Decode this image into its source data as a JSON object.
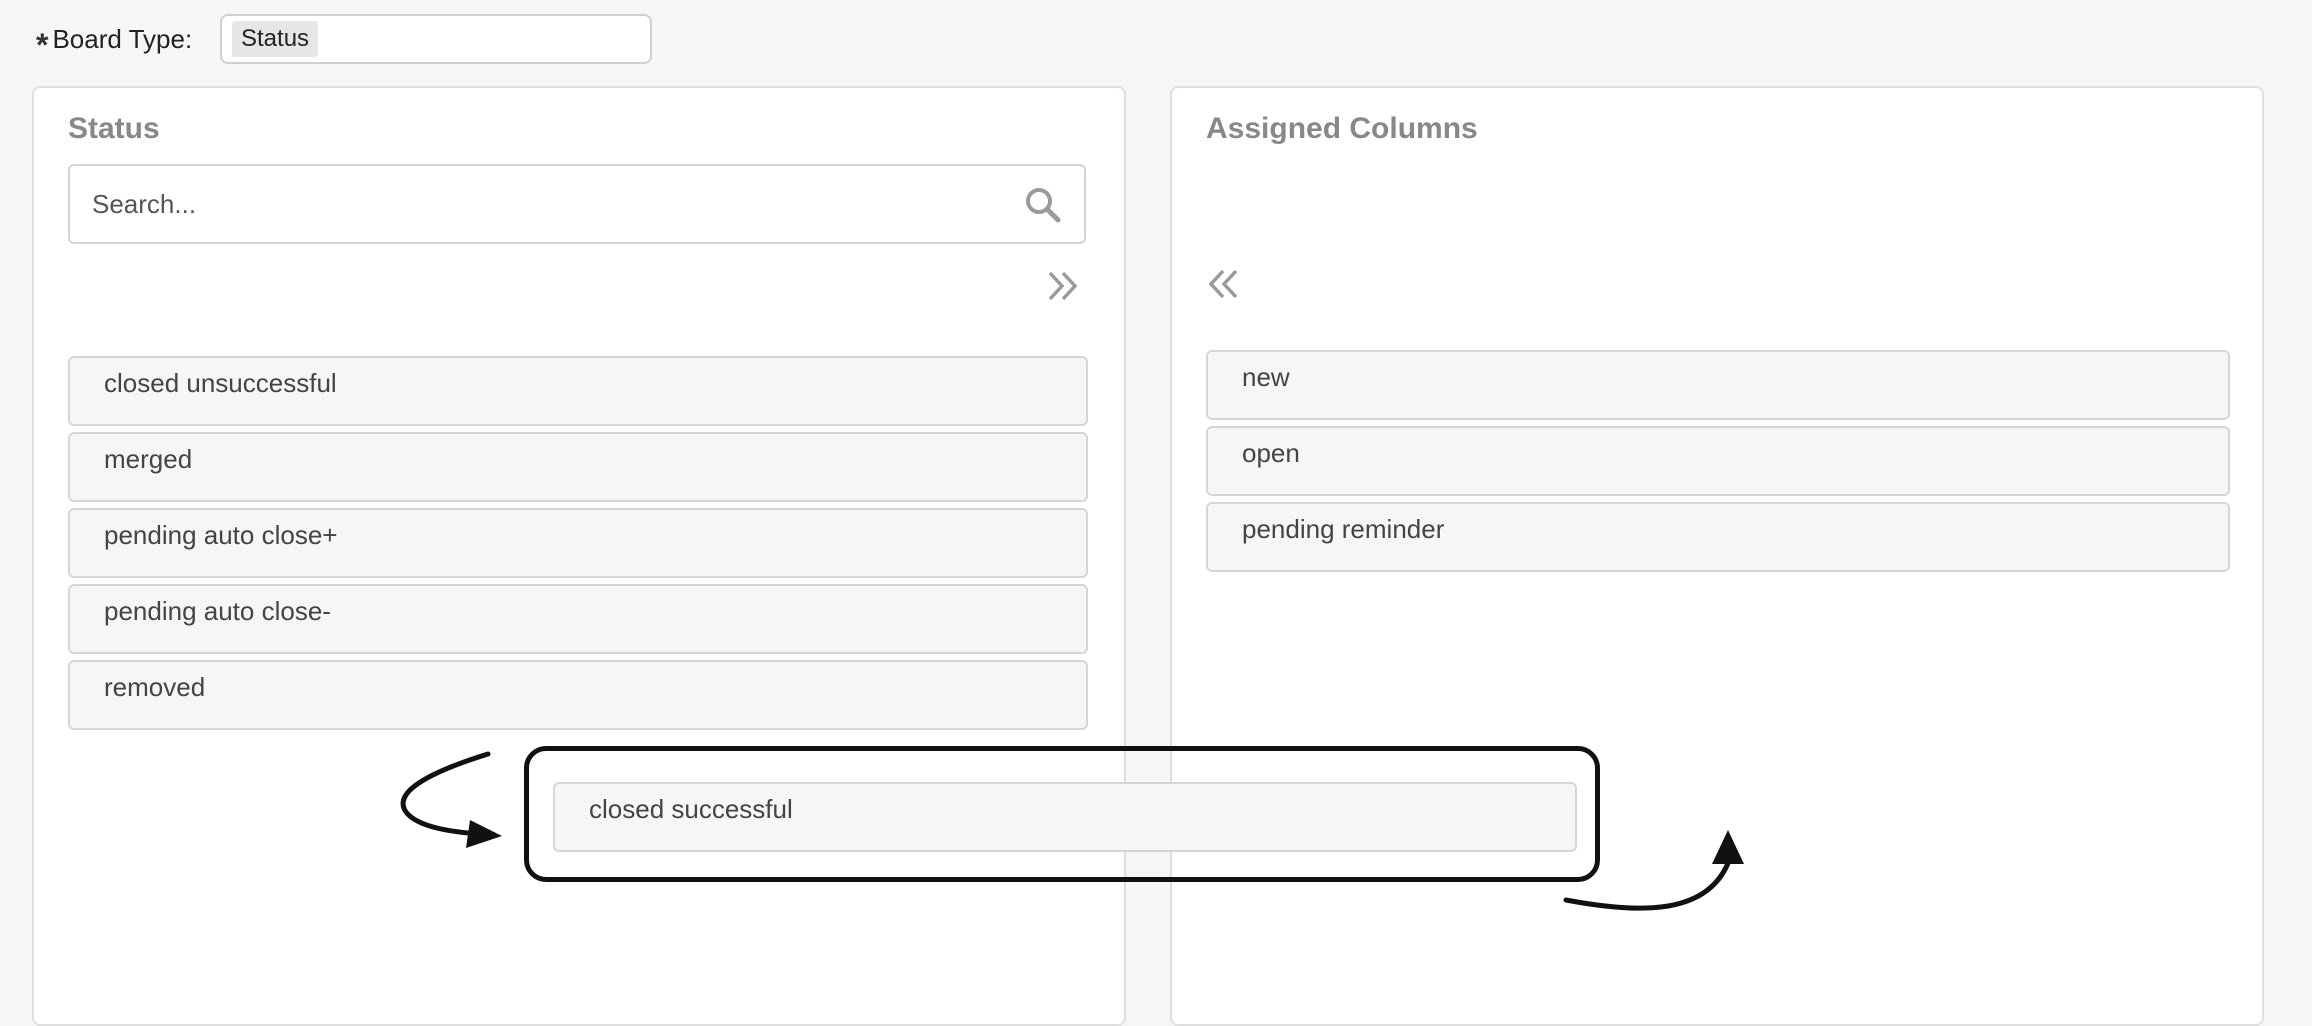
{
  "board_type": {
    "required_mark": "*",
    "label": "Board Type:",
    "selected_value": "Status"
  },
  "left_panel": {
    "title": "Status",
    "search_placeholder": "Search...",
    "move_right_icon": "double-chevron-right-icon",
    "items": [
      {
        "label": "closed unsuccessful"
      },
      {
        "label": "merged"
      },
      {
        "label": "pending auto close+"
      },
      {
        "label": "pending auto close-"
      },
      {
        "label": "removed"
      }
    ]
  },
  "right_panel": {
    "title": "Assigned Columns",
    "move_left_icon": "double-chevron-left-icon",
    "items": [
      {
        "label": "new"
      },
      {
        "label": "open"
      },
      {
        "label": "pending reminder"
      }
    ]
  },
  "dragged_item": {
    "label": "closed successful"
  }
}
